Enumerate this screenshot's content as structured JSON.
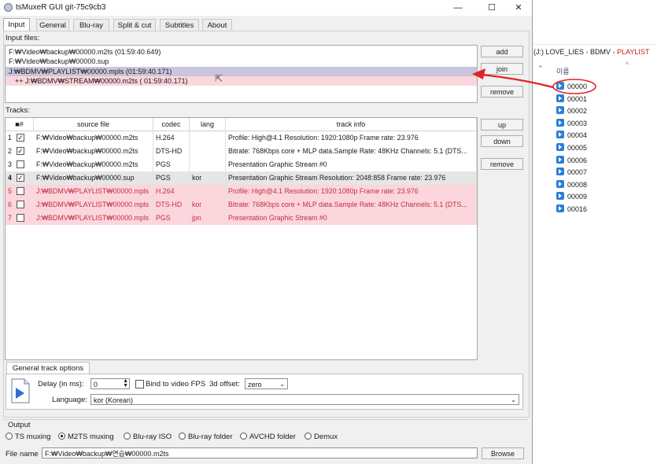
{
  "window": {
    "title": "tsMuxeR GUI git-75c9cb3",
    "minimize": "—",
    "maximize": "☐",
    "close": "✕"
  },
  "tabs": [
    "Input",
    "General",
    "Blu-ray",
    "Split & cut",
    "Subtitles",
    "About"
  ],
  "input_files": {
    "label": "Input files:",
    "rows": [
      "F:₩Video₩backup₩00000.m2ts (01:59:40.649)",
      "F:₩Video₩backup₩00000.sup",
      "J:₩BDMV₩PLAYLIST₩00000.mpls (01:59:40.171)",
      "++ J:₩BDMV₩STREAM₩00000.m2ts ( 01:59:40.171)"
    ],
    "buttons": {
      "add": "add",
      "join": "join",
      "remove": "remove"
    }
  },
  "tracks": {
    "label": "Tracks:",
    "headers": {
      "check": "■#",
      "source": "source file",
      "codec": "codec",
      "lang": "lang",
      "info": "track info"
    },
    "buttons": {
      "up": "up",
      "down": "down",
      "remove": "remove"
    },
    "rows": [
      {
        "num": "1",
        "checked": "✓",
        "source": "F:₩Video₩backup₩00000.m2ts",
        "codec": "H.264",
        "lang": "",
        "info": "Profile: High@4.1  Resolution: 1920:1080p  Frame rate: 23.976"
      },
      {
        "num": "2",
        "checked": "✓",
        "source": "F:₩Video₩backup₩00000.m2ts",
        "codec": "DTS-HD",
        "lang": "",
        "info": "Bitrate: 768Kbps  core + MLP data.Sample Rate: 48KHz  Channels: 5.1 (DTS..."
      },
      {
        "num": "3",
        "checked": "",
        "source": "F:₩Video₩backup₩00000.m2ts",
        "codec": "PGS",
        "lang": "",
        "info": "Presentation Graphic Stream #0"
      },
      {
        "num": "4",
        "checked": "✓",
        "source": "F:₩Video₩backup₩00000.sup",
        "codec": "PGS",
        "lang": "kor",
        "info": "Presentation Graphic Stream Resolution: 2048:858 Frame rate: 23.976"
      },
      {
        "num": "5",
        "checked": "",
        "source": "J:₩BDMV₩PLAYLIST₩00000.mpls",
        "codec": "H.264",
        "lang": "",
        "info": "Profile: High@4.1  Resolution: 1920:1080p  Frame rate: 23.976"
      },
      {
        "num": "6",
        "checked": "",
        "source": "J:₩BDMV₩PLAYLIST₩00000.mpls",
        "codec": "DTS-HD",
        "lang": "kor",
        "info": "Bitrate: 768Kbps  core + MLP data.Sample Rate: 48KHz  Channels: 5.1 (DTS..."
      },
      {
        "num": "7",
        "checked": "",
        "source": "J:₩BDMV₩PLAYLIST₩00000.mpls",
        "codec": "PGS",
        "lang": "jpn",
        "info": "Presentation Graphic Stream #0"
      }
    ]
  },
  "general_track_options": {
    "tab": "General track options",
    "delay_label": "Delay (in ms):",
    "delay_value": "0",
    "bind_fps": "Bind to video FPS",
    "offset_label": "3d offset:",
    "offset_value": "zero",
    "language_label": "Language:",
    "language_value": "kor (Korean)"
  },
  "output": {
    "label": "Output",
    "options": [
      "TS muxing",
      "M2TS muxing",
      "Blu-ray ISO",
      "Blu-ray folder",
      "AVCHD folder",
      "Demux"
    ],
    "selected": "M2TS muxing",
    "filename_label": "File name",
    "filename_value": "F:₩Video₩backup₩연습₩00000.m2ts",
    "browse": "Browse"
  },
  "explorer": {
    "breadcrumb": [
      "(J:) LOVE_LIES",
      "BDMV",
      "PLAYLIST"
    ],
    "column_header": "이름",
    "files": [
      "00000",
      "00001",
      "00002",
      "00003",
      "00004",
      "00005",
      "00006",
      "00007",
      "00008",
      "00009",
      "00016"
    ],
    "selected_file": "00000"
  },
  "colors": {
    "pink_row": "#fbd6dc",
    "selected_row": "#c9c6dd",
    "annotation_red": "#e2222a",
    "file_icon": "#2a7fd4"
  }
}
